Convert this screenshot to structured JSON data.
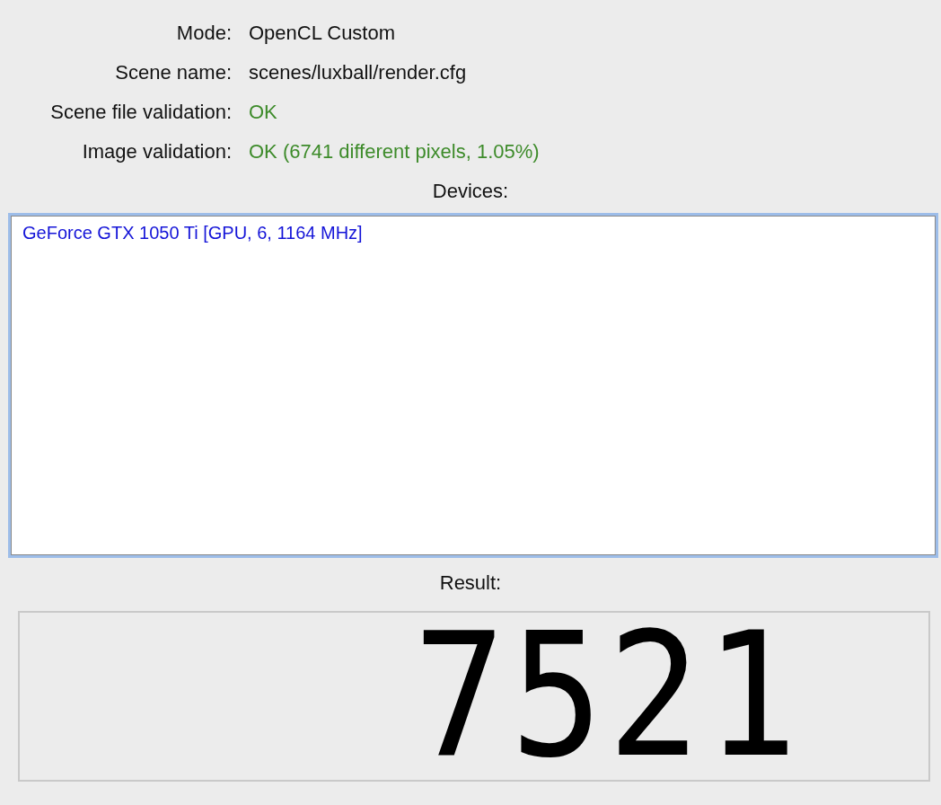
{
  "fields": [
    {
      "label": "Mode:",
      "value": "OpenCL Custom",
      "kind": "plain"
    },
    {
      "label": "Scene name:",
      "value": "scenes/luxball/render.cfg",
      "kind": "plain"
    },
    {
      "label": "Scene file validation:",
      "value": "OK",
      "kind": "ok"
    },
    {
      "label": "Image validation:",
      "value": "OK (6741 different pixels, 1.05%)",
      "kind": "ok"
    }
  ],
  "devices": {
    "title": "Devices:",
    "items": [
      "GeForce GTX 1050 Ti [GPU, 6, 1164 MHz]"
    ]
  },
  "result": {
    "title": "Result:",
    "value": "7521"
  }
}
